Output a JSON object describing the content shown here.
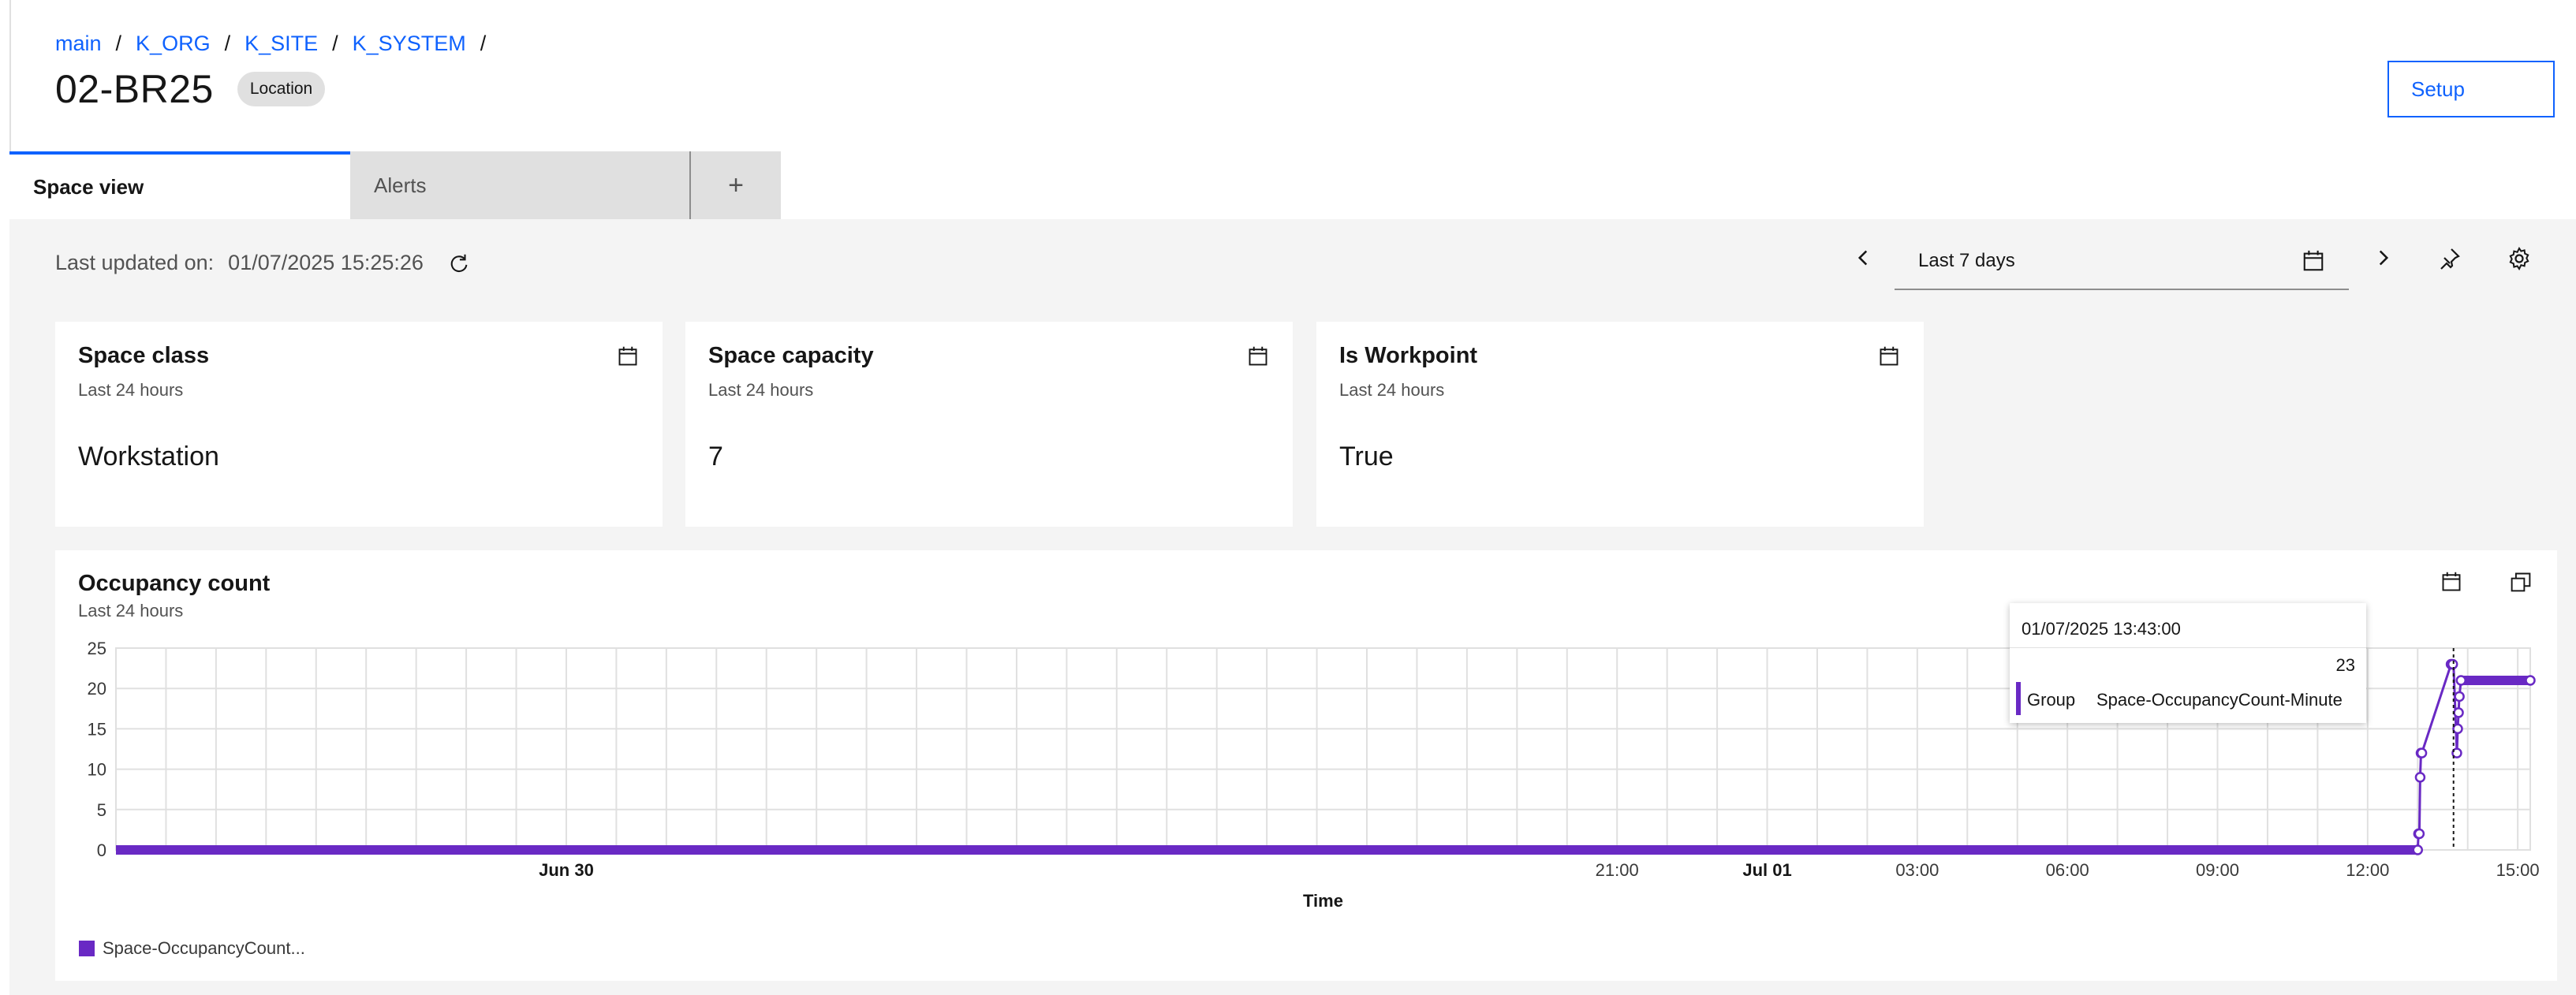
{
  "breadcrumb": [
    "main",
    "K_ORG",
    "K_SITE",
    "K_SYSTEM"
  ],
  "header": {
    "title": "02-BR25",
    "tag": "Location",
    "setup_label": "Setup"
  },
  "tabs": {
    "space_view": "Space view",
    "alerts": "Alerts",
    "add": "+"
  },
  "toolbar": {
    "last_updated_label": "Last updated on:",
    "last_updated_value": "01/07/2025 15:25:26",
    "range": "Last 7 days"
  },
  "cards": [
    {
      "title": "Space class",
      "subtitle": "Last 24 hours",
      "value": "Workstation"
    },
    {
      "title": "Space capacity",
      "subtitle": "Last 24 hours",
      "value": "7"
    },
    {
      "title": "Is Workpoint",
      "subtitle": "Last 24 hours",
      "value": "True"
    }
  ],
  "chart_card": {
    "title": "Occupancy count",
    "subtitle": "Last 24 hours"
  },
  "tooltip": {
    "timestamp": "01/07/2025 13:43:00",
    "value": "23",
    "label": "Group",
    "series": "Space-OccupancyCount-Minute"
  },
  "legend": {
    "label": "Space-OccupancyCount..."
  },
  "colors": {
    "accent": "#0f62fe",
    "series": "#6929c4",
    "background": "#f4f4f4"
  },
  "chart_data": {
    "type": "line",
    "xlabel": "Time",
    "ylabel": "",
    "ylim": [
      0,
      25
    ],
    "yticks": [
      0,
      5,
      10,
      15,
      20,
      25
    ],
    "xlim": [
      "2025-06-29T15:00",
      "2025-07-01T15:15"
    ],
    "xticks": [
      {
        "t": "2025-06-30T00:00",
        "label": "Jun 30",
        "bold": true
      },
      {
        "t": "2025-06-30T21:00",
        "label": "21:00",
        "bold": false
      },
      {
        "t": "2025-07-01T00:00",
        "label": "Jul 01",
        "bold": true
      },
      {
        "t": "2025-07-01T03:00",
        "label": "03:00",
        "bold": false
      },
      {
        "t": "2025-07-01T06:00",
        "label": "06:00",
        "bold": false
      },
      {
        "t": "2025-07-01T09:00",
        "label": "09:00",
        "bold": false
      },
      {
        "t": "2025-07-01T12:00",
        "label": "12:00",
        "bold": false
      },
      {
        "t": "2025-07-01T15:00",
        "label": "15:00",
        "bold": false
      }
    ],
    "grid": true,
    "legend_position": "bottom-left",
    "series": [
      {
        "name": "Space-OccupancyCount-Minute",
        "points": [
          [
            "2025-06-29T15:00",
            0
          ],
          [
            "2025-06-29T18:00",
            0
          ],
          [
            "2025-06-29T21:00",
            0
          ],
          [
            "2025-06-30T00:00",
            0
          ],
          [
            "2025-06-30T21:00",
            0
          ],
          [
            "2025-07-01T00:00",
            0
          ],
          [
            "2025-07-01T03:00",
            0
          ],
          [
            "2025-07-01T06:00",
            0
          ],
          [
            "2025-07-01T09:00",
            0
          ],
          [
            "2025-07-01T12:00",
            0
          ],
          [
            "2025-07-01T13:00",
            0
          ],
          [
            "2025-07-01T13:01",
            2
          ],
          [
            "2025-07-01T13:02",
            2
          ],
          [
            "2025-07-01T13:03",
            9
          ],
          [
            "2025-07-01T13:04",
            12
          ],
          [
            "2025-07-01T13:05",
            12
          ],
          [
            "2025-07-01T13:40",
            23
          ],
          [
            "2025-07-01T13:41",
            23
          ],
          [
            "2025-07-01T13:42",
            23
          ],
          [
            "2025-07-01T13:43",
            23
          ],
          [
            "2025-07-01T13:47",
            12
          ],
          [
            "2025-07-01T13:48",
            15
          ],
          [
            "2025-07-01T13:49",
            17
          ],
          [
            "2025-07-01T13:50",
            19
          ],
          [
            "2025-07-01T13:52",
            21
          ],
          [
            "2025-07-01T14:00",
            21
          ],
          [
            "2025-07-01T14:30",
            21
          ],
          [
            "2025-07-01T15:00",
            21
          ],
          [
            "2025-07-01T15:15",
            21
          ]
        ],
        "marked_points": [
          [
            "2025-07-01T13:00",
            0
          ],
          [
            "2025-07-01T13:01",
            2
          ],
          [
            "2025-07-01T13:02",
            2
          ],
          [
            "2025-07-01T13:03",
            9
          ],
          [
            "2025-07-01T13:04",
            12
          ],
          [
            "2025-07-01T13:05",
            12
          ],
          [
            "2025-07-01T13:40",
            23
          ],
          [
            "2025-07-01T13:42",
            23
          ],
          [
            "2025-07-01T13:47",
            12
          ],
          [
            "2025-07-01T13:48",
            15
          ],
          [
            "2025-07-01T13:49",
            17
          ],
          [
            "2025-07-01T13:50",
            19
          ],
          [
            "2025-07-01T13:52",
            21
          ],
          [
            "2025-07-01T15:15",
            21
          ]
        ]
      }
    ],
    "hover_time": "2025-07-01T13:43"
  }
}
